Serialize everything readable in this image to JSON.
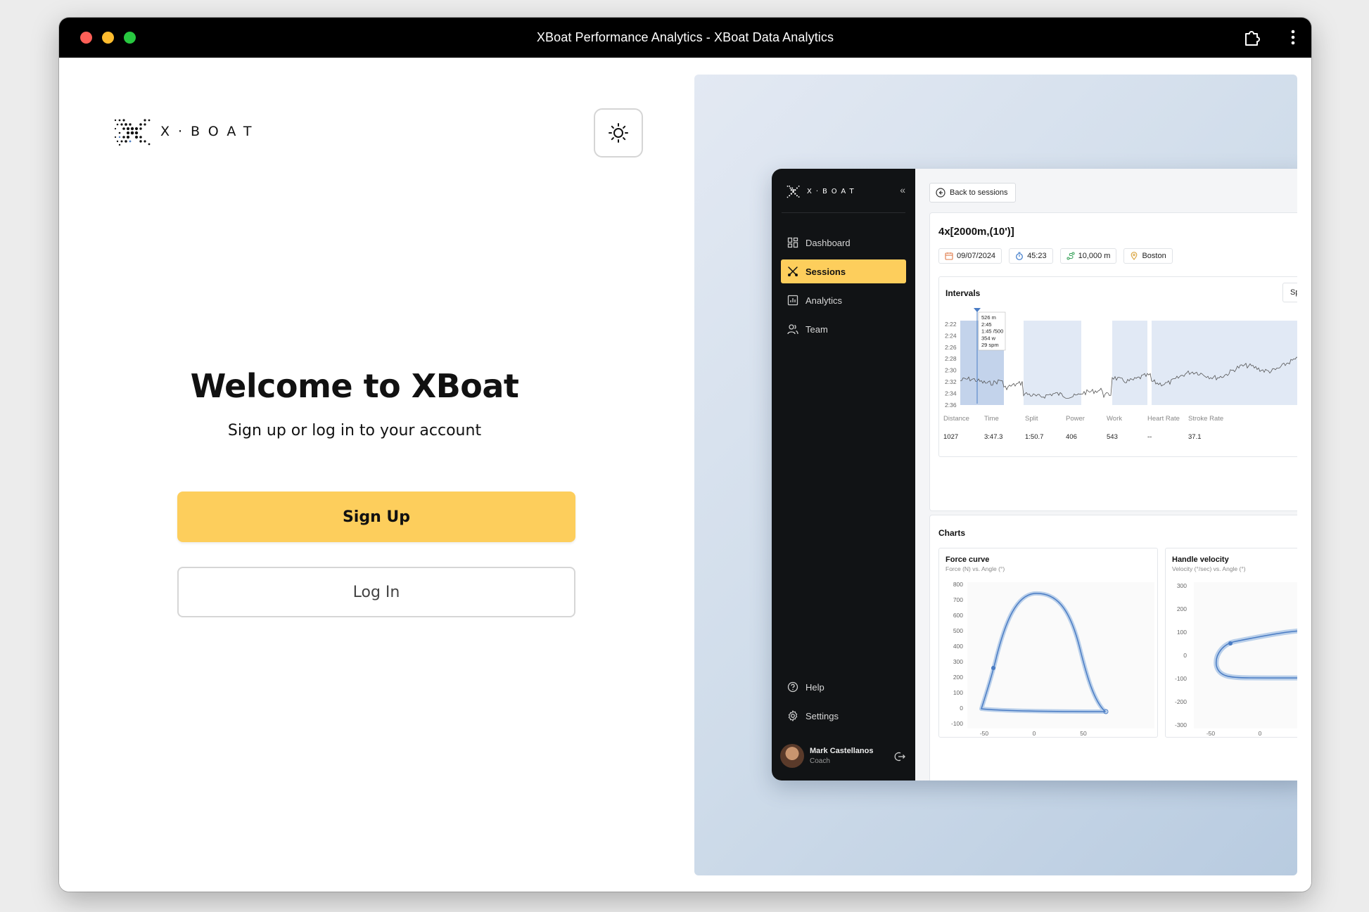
{
  "window": {
    "title": "XBoat Performance Analytics - XBoat Data Analytics"
  },
  "brand": {
    "logo_text": "X·BOAT"
  },
  "welcome": {
    "heading": "Welcome to XBoat",
    "subheading": "Sign up or log in to your account",
    "signup_label": "Sign Up",
    "login_label": "Log In"
  },
  "colors": {
    "accent": "#fdce5c",
    "sidebar_bg": "#111315",
    "chart_blue": "#4a7cc4"
  },
  "preview": {
    "sidebar": {
      "logo_text": "X·BOAT",
      "nav": [
        {
          "label": "Dashboard",
          "icon": "dashboard-icon",
          "active": false
        },
        {
          "label": "Sessions",
          "icon": "sessions-icon",
          "active": true
        },
        {
          "label": "Analytics",
          "icon": "analytics-icon",
          "active": false
        },
        {
          "label": "Team",
          "icon": "team-icon",
          "active": false
        }
      ],
      "bottom": [
        {
          "label": "Help",
          "icon": "help-icon"
        },
        {
          "label": "Settings",
          "icon": "gear-icon"
        }
      ],
      "user": {
        "name": "Mark Castellanos",
        "role": "Coach"
      }
    },
    "back_label": "Back to sessions",
    "session": {
      "title": "4x[2000m,(10')]",
      "date": "09/07/2024",
      "duration": "45:23",
      "distance": "10,000 m",
      "location": "Boston"
    },
    "intervals": {
      "title": "Intervals",
      "select_value": "Split",
      "y_ticks": [
        "2:22",
        "2:24",
        "2:26",
        "2:28",
        "2:30",
        "2:32",
        "2:34",
        "2:36"
      ],
      "tooltip": [
        "526 m",
        "2:45",
        "1:45 /500",
        "354 w",
        "29 spm"
      ],
      "columns": [
        "Distance",
        "Time",
        "Split",
        "Power",
        "Work",
        "Heart Rate",
        "Stroke Rate"
      ],
      "row": [
        "1027",
        "3:47.3",
        "1:50.7",
        "406",
        "543",
        "--",
        "37.1"
      ]
    },
    "charts": {
      "title": "Charts",
      "force": {
        "title": "Force curve",
        "subtitle": "Force (N) vs. Angle (°)",
        "y_ticks": [
          "800",
          "700",
          "600",
          "500",
          "400",
          "300",
          "200",
          "100",
          "0",
          "-100"
        ],
        "x_ticks": [
          "-50",
          "0",
          "50"
        ]
      },
      "handle": {
        "title": "Handle velocity",
        "subtitle": "Velocity (°/sec) vs. Angle (°)",
        "y_ticks": [
          "300",
          "200",
          "100",
          "0",
          "-100",
          "-200",
          "-300"
        ],
        "x_ticks": [
          "-50",
          "0"
        ]
      }
    }
  }
}
